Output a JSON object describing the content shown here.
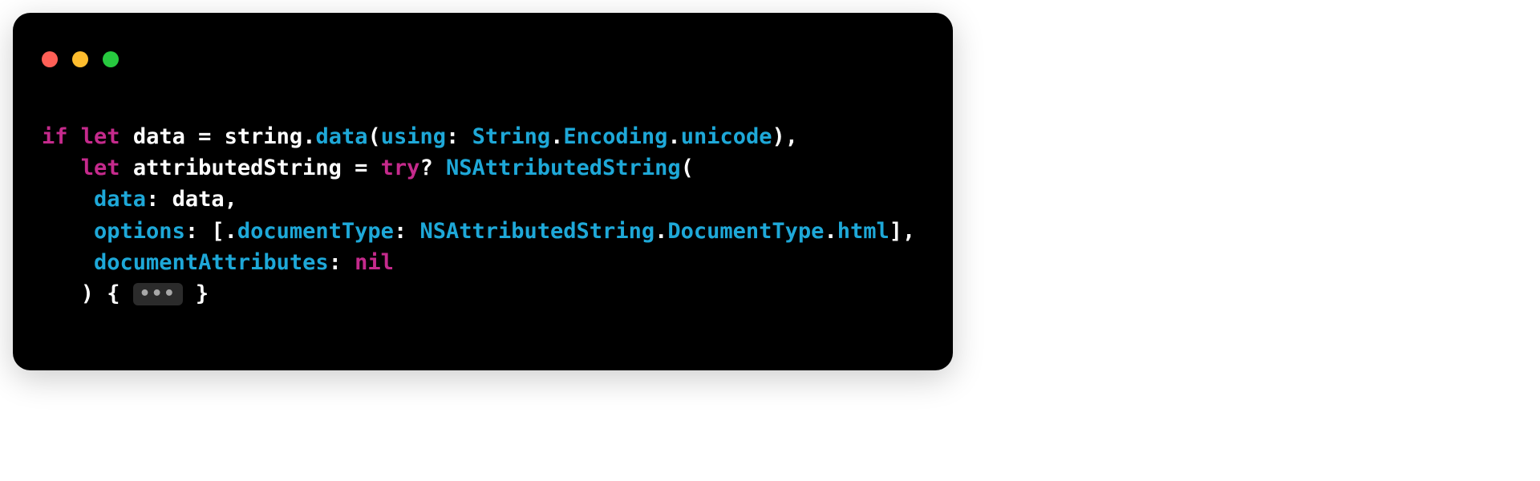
{
  "window": {
    "traffic_lights": {
      "close": "red",
      "minimize": "yellow",
      "zoom": "green"
    }
  },
  "code": {
    "line1": {
      "kw_if": "if",
      "kw_let1": "let",
      "ident_data": "data",
      "eq": " = ",
      "ident_string": "string",
      "dot1": ".",
      "call_data": "data",
      "p_open1": "(",
      "param_using": "using",
      "colon1": ":",
      "sp1": " ",
      "type_string": "String",
      "dot2": ".",
      "type_encoding": "Encoding",
      "dot3": ".",
      "type_unicode": "unicode",
      "p_close_comma": "),"
    },
    "line2": {
      "indent": "   ",
      "kw_let2": "let",
      "ident_attr": " attributedString = ",
      "kw_try": "try",
      "qmark": "?",
      "sp": " ",
      "type_nsattr": "NSAttributedString",
      "p_open": "("
    },
    "line3": {
      "indent": "    ",
      "param_data": "data",
      "colon": ":",
      "rest": " data,"
    },
    "line4": {
      "indent": "    ",
      "param_options": "options",
      "colon": ":",
      "sp": " ",
      "brk_open": "[.",
      "key_documentType": "documentType",
      "colon2": ":",
      "sp2": " ",
      "t_nsattr": "NSAttributedString",
      "dot1": ".",
      "t_doctype": "DocumentType",
      "dot2": ".",
      "t_html": "html",
      "brk_close": "],"
    },
    "line5": {
      "indent": "    ",
      "param_docattr": "documentAttributes",
      "colon": ":",
      "sp": " ",
      "kw_nil": "nil"
    },
    "line6": {
      "indent": "   ",
      "close_paren": ") { ",
      "fold": "•••",
      "close_brace": " }"
    }
  }
}
